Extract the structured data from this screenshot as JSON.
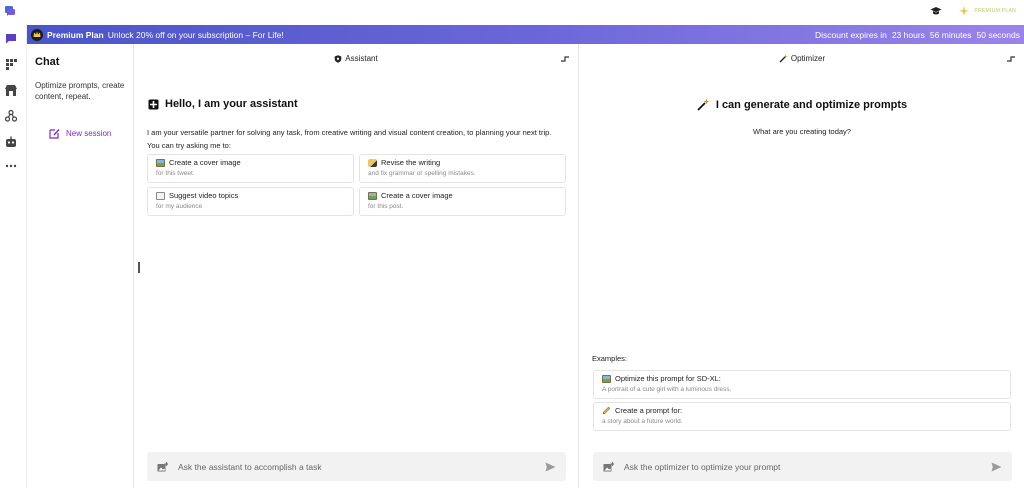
{
  "topbar": {
    "premium_badge": "PREMIUM PLAN",
    "icons": [
      "app-logo-icon",
      "graduation-cap-icon",
      "sparkle-icon"
    ]
  },
  "banner": {
    "plan": "Premium Plan",
    "message": "Unlock 20% off on your subscription – For Life!",
    "expires_label": "Discount expires in",
    "hours": "23 hours",
    "minutes": "56 minutes",
    "seconds": "50 seconds"
  },
  "rail": {
    "icons": [
      "chat-icon",
      "grid-icon",
      "store-icon",
      "network-icon",
      "robot-icon",
      "more-icon"
    ]
  },
  "chat": {
    "title": "Chat",
    "description": "Optimize prompts, create content, repeat.",
    "new_session": "New session"
  },
  "assistant": {
    "header": "Assistant",
    "greeting": "Hello, I am your assistant",
    "intro_line1": "I am your versatile partner for solving any task, from creative writing and visual content creation, to planning your next trip.",
    "intro_line2": "You can try asking me to:",
    "cards": [
      {
        "title": "Create a cover image",
        "subtitle": "for this tweet.",
        "icon": "picture-icon"
      },
      {
        "title": "Revise the writing",
        "subtitle": "and fix grammar or spelling mistakes.",
        "icon": "writing-hand-icon"
      },
      {
        "title": "Suggest video topics",
        "subtitle": "for my audience",
        "icon": "notepad-icon"
      },
      {
        "title": "Create a cover image",
        "subtitle": "for this post.",
        "icon": "picture-icon"
      }
    ],
    "input_placeholder": "Ask the assistant to accomplish a task"
  },
  "optimizer": {
    "header": "Optimizer",
    "title": "I can generate and optimize prompts",
    "subtitle": "What are you creating today?",
    "examples_label": "Examples:",
    "examples": [
      {
        "title": "Optimize this prompt for SD-XL:",
        "subtitle": "A portrait of a cute girl with a luminous dress.",
        "icon": "picture-icon"
      },
      {
        "title": "Create a prompt for:",
        "subtitle": "a story about a future world.",
        "icon": "pencil-icon"
      }
    ],
    "input_placeholder": "Ask the optimizer to optimize your prompt"
  },
  "colors": {
    "accent": "#7a2fc4",
    "banner_start": "#4a55c8",
    "banner_end": "#9a84ea",
    "rail_icon": "#5b3fc4"
  }
}
